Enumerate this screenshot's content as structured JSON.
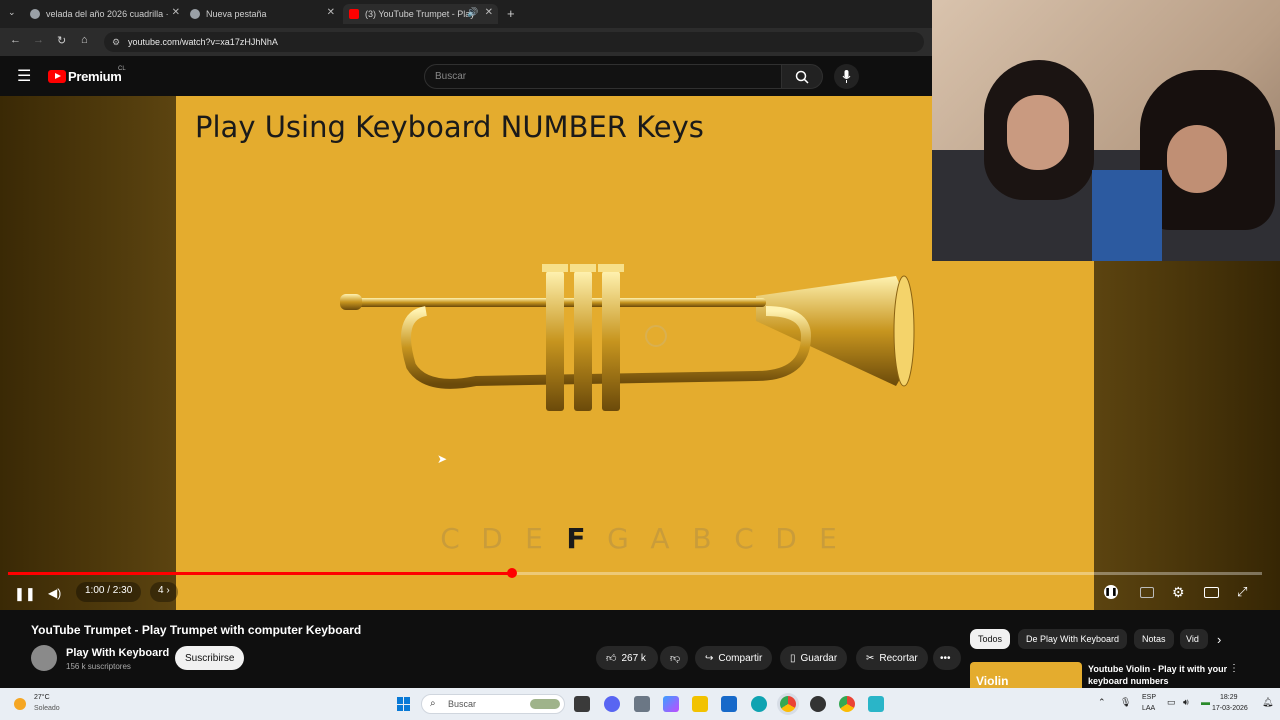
{
  "browser": {
    "tabs": [
      {
        "title": "velada del año 2026 cuadrilla ·",
        "active": false
      },
      {
        "title": "Nueva pestaña",
        "active": false
      },
      {
        "title": "(3) YouTube Trumpet - Play",
        "active": true
      }
    ],
    "url": "youtube.com/watch?v=xa17zHJhNhA"
  },
  "youtube": {
    "logo": "Premium",
    "logo_sup": "CL",
    "search_placeholder": "Buscar"
  },
  "video": {
    "frame_title": "Play Using Keyboard NUMBER Keys",
    "notes": [
      "C",
      "D",
      "E",
      "F",
      "G",
      "A",
      "B",
      "C",
      "D",
      "E"
    ],
    "highlighted_note_index": 3,
    "time": "1:00 / 2:30",
    "chapter": "4",
    "progress_fraction": 0.402
  },
  "meta": {
    "title": "YouTube Trumpet - Play Trumpet with computer Keyboard",
    "channel": "Play With Keyboard",
    "subscribers": "156 k suscriptores",
    "subscribe_label": "Suscribirse",
    "likes": "267 k",
    "share": "Compartir",
    "save": "Guardar",
    "clip": "Recortar"
  },
  "sidebar": {
    "chips": [
      "Todos",
      "De Play With Keyboard",
      "Notas",
      "Vid"
    ],
    "rec_title": "Youtube Violin - Play it with your keyboard numbers",
    "rec_thumb_label": "Violin"
  },
  "taskbar": {
    "temp": "27°C",
    "weather": "Soleado",
    "search": "Buscar",
    "lang1": "ESP",
    "lang2": "LAA",
    "time": "18:29",
    "date": "17-03-2026"
  },
  "colors": {
    "accent": "#ff0000",
    "frame": "#e4ac2e"
  }
}
